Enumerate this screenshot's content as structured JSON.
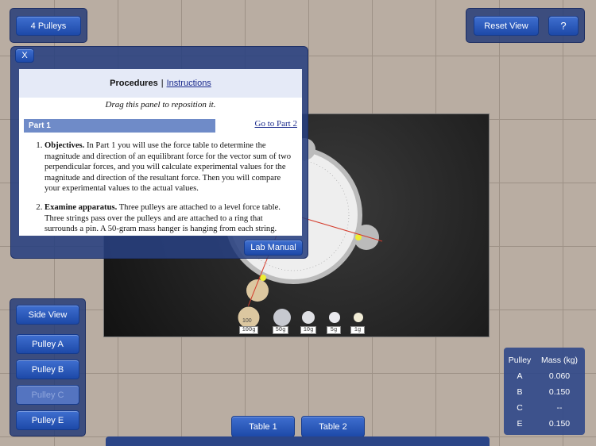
{
  "top_left": {
    "pulleys_label": "4 Pulleys"
  },
  "top_right": {
    "reset_label": "Reset View",
    "help_label": "?"
  },
  "panel": {
    "close_label": "X",
    "tab_active": "Procedures",
    "separator": "|",
    "tab_link": "Instructions",
    "drag_hint": "Drag this panel to reposition it.",
    "part_title": "Part 1",
    "go_to_part": "Go to Part 2",
    "steps": [
      {
        "num": "1.",
        "title": "Objectives.",
        "text": " In Part 1 you will use the force table to determine the magnitude and direction of an equilibrant force for the vector sum of two perpendicular forces, and you will calculate experimental values for the magnitude and direction of the resultant force. Then you will compare your experimental values to the actual values."
      },
      {
        "num": "2.",
        "title": "Examine apparatus.",
        "text": " Three pulleys are attached to a level force table. Three strings pass over the pulleys and are attached to a ring that surrounds a pin. A 50-gram mass hanger is hanging from each string."
      }
    ],
    "lab_manual_label": "Lab Manual"
  },
  "masses": [
    "100g",
    "50g",
    "10g",
    "5g",
    "1g"
  ],
  "hanger_label": "100",
  "left_buttons": {
    "side_view": "Side View",
    "pulley_a": "Pulley A",
    "pulley_b": "Pulley B",
    "pulley_c": "Pulley C",
    "pulley_e": "Pulley E"
  },
  "bottom_tabs": {
    "table1": "Table 1",
    "table2": "Table 2"
  },
  "mass_table": {
    "headers": [
      "Pulley",
      "Mass (kg)"
    ],
    "rows": [
      {
        "pulley": "A",
        "mass": "0.060"
      },
      {
        "pulley": "B",
        "mass": "0.150"
      },
      {
        "pulley": "C",
        "mass": "--"
      },
      {
        "pulley": "E",
        "mass": "0.150"
      }
    ]
  },
  "colors": {
    "button": "#2a58bb",
    "panel": "#283f80",
    "part_bar": "#6f8bc8",
    "string": "#d43a2a"
  }
}
